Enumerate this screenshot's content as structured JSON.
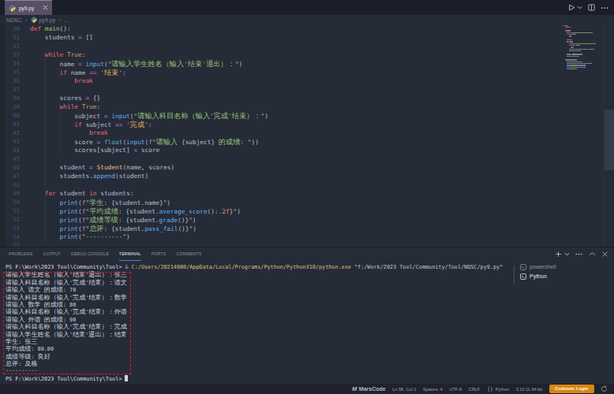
{
  "tab": {
    "label": "py9.py",
    "close_label": "×"
  },
  "editor_actions": {
    "run": "run-python-file",
    "split": "split-editor",
    "more": "more-actions"
  },
  "breadcrumb": {
    "root": "NDSC",
    "file": "py9.py",
    "symbol": "…"
  },
  "editor": {
    "lines": [
      {
        "n": 30,
        "t": [
          [
            "kw",
            "def"
          ],
          [
            "pln",
            " "
          ],
          [
            "fn",
            "main"
          ],
          [
            "pln",
            "():"
          ]
        ]
      },
      {
        "n": 31,
        "t": [
          [
            "pln",
            "    students "
          ],
          [
            "opr",
            "="
          ],
          [
            "pln",
            " []"
          ]
        ]
      },
      {
        "n": 32,
        "t": []
      },
      {
        "n": 33,
        "t": [
          [
            "pln",
            "    "
          ],
          [
            "kw",
            "while"
          ],
          [
            "pln",
            " "
          ],
          [
            "num",
            "True"
          ],
          [
            "pln",
            ":"
          ]
        ]
      },
      {
        "n": 34,
        "t": [
          [
            "pln",
            "        name "
          ],
          [
            "opr",
            "="
          ],
          [
            "pln",
            " "
          ],
          [
            "call",
            "input"
          ],
          [
            "pln",
            "("
          ],
          [
            "str",
            "\"请输入学生姓名（输入'结束'退出）：\""
          ],
          [
            "pln",
            ")"
          ]
        ]
      },
      {
        "n": 35,
        "t": [
          [
            "pln",
            "        "
          ],
          [
            "kw",
            "if"
          ],
          [
            "pln",
            " name "
          ],
          [
            "opr",
            "=="
          ],
          [
            "pln",
            " "
          ],
          [
            "sqs",
            "'结束'"
          ],
          [
            "pln",
            ":"
          ]
        ]
      },
      {
        "n": 36,
        "t": [
          [
            "pln",
            "            "
          ],
          [
            "kw",
            "break"
          ]
        ]
      },
      {
        "n": 37,
        "t": []
      },
      {
        "n": 38,
        "t": [
          [
            "pln",
            "        scores "
          ],
          [
            "opr",
            "="
          ],
          [
            "pln",
            " {}"
          ]
        ]
      },
      {
        "n": 39,
        "t": [
          [
            "pln",
            "        "
          ],
          [
            "kw",
            "while"
          ],
          [
            "pln",
            " "
          ],
          [
            "num",
            "True"
          ],
          [
            "pln",
            ":"
          ]
        ]
      },
      {
        "n": 40,
        "t": [
          [
            "pln",
            "            subject "
          ],
          [
            "opr",
            "="
          ],
          [
            "pln",
            " "
          ],
          [
            "call",
            "input"
          ],
          [
            "pln",
            "("
          ],
          [
            "str",
            "\"请输入科目名称（输入'完成'结束）：\""
          ],
          [
            "pln",
            ")"
          ]
        ]
      },
      {
        "n": 41,
        "t": [
          [
            "pln",
            "            "
          ],
          [
            "kw",
            "if"
          ],
          [
            "pln",
            " subject "
          ],
          [
            "opr",
            "=="
          ],
          [
            "pln",
            " "
          ],
          [
            "sqs",
            "'完成'"
          ],
          [
            "pln",
            ":"
          ]
        ]
      },
      {
        "n": 42,
        "t": [
          [
            "pln",
            "                "
          ],
          [
            "kw",
            "break"
          ]
        ]
      },
      {
        "n": 43,
        "t": [
          [
            "pln",
            "            score "
          ],
          [
            "opr",
            "="
          ],
          [
            "pln",
            " "
          ],
          [
            "cyn",
            "float"
          ],
          [
            "pln",
            "("
          ],
          [
            "call",
            "input"
          ],
          [
            "pln",
            "("
          ],
          [
            "fpx",
            "f"
          ],
          [
            "str",
            "\"请输入 "
          ],
          [
            "pln",
            "{subject}"
          ],
          [
            "str",
            " 的成绩: \""
          ],
          [
            "pln",
            "))"
          ]
        ]
      },
      {
        "n": 44,
        "t": [
          [
            "pln",
            "            scores[subject] "
          ],
          [
            "opr",
            "="
          ],
          [
            "pln",
            " score"
          ]
        ]
      },
      {
        "n": 45,
        "t": []
      },
      {
        "n": 46,
        "t": [
          [
            "pln",
            "        student "
          ],
          [
            "opr",
            "="
          ],
          [
            "pln",
            " "
          ],
          [
            "cls",
            "Student"
          ],
          [
            "pln",
            "(name, scores)"
          ]
        ]
      },
      {
        "n": 47,
        "t": [
          [
            "pln",
            "        students."
          ],
          [
            "call",
            "append"
          ],
          [
            "pln",
            "(student)"
          ]
        ]
      },
      {
        "n": 48,
        "t": []
      },
      {
        "n": 49,
        "t": [
          [
            "pln",
            "    "
          ],
          [
            "kw",
            "for"
          ],
          [
            "pln",
            " student "
          ],
          [
            "kw",
            "in"
          ],
          [
            "pln",
            " students:"
          ]
        ]
      },
      {
        "n": 50,
        "t": [
          [
            "pln",
            "        "
          ],
          [
            "call",
            "print"
          ],
          [
            "pln",
            "("
          ],
          [
            "fpx",
            "f"
          ],
          [
            "str",
            "\"学生: "
          ],
          [
            "pln",
            "{student.name}"
          ],
          [
            "str",
            "\""
          ],
          [
            "pln",
            ")"
          ]
        ]
      },
      {
        "n": 51,
        "t": [
          [
            "pln",
            "        "
          ],
          [
            "call",
            "print"
          ],
          [
            "pln",
            "("
          ],
          [
            "fpx",
            "f"
          ],
          [
            "str",
            "\"平均成绩: "
          ],
          [
            "pln",
            "{student."
          ],
          [
            "call",
            "average_score"
          ],
          [
            "pln",
            "()"
          ],
          [
            "fmt",
            ":.2f"
          ],
          [
            "pln",
            "}"
          ],
          [
            "str",
            "\""
          ],
          [
            "pln",
            ")"
          ]
        ]
      },
      {
        "n": 52,
        "t": [
          [
            "pln",
            "        "
          ],
          [
            "call",
            "print"
          ],
          [
            "pln",
            "("
          ],
          [
            "fpx",
            "f"
          ],
          [
            "str",
            "\"成绩等级: "
          ],
          [
            "pln",
            "{student."
          ],
          [
            "call",
            "grade"
          ],
          [
            "pln",
            "()}"
          ],
          [
            "str",
            "\""
          ],
          [
            "pln",
            ")"
          ]
        ]
      },
      {
        "n": 53,
        "t": [
          [
            "pln",
            "        "
          ],
          [
            "call",
            "print"
          ],
          [
            "pln",
            "("
          ],
          [
            "fpx",
            "f"
          ],
          [
            "str",
            "\"总评: "
          ],
          [
            "pln",
            "{student."
          ],
          [
            "call",
            "pass_fail"
          ],
          [
            "pln",
            "()}"
          ],
          [
            "str",
            "\""
          ],
          [
            "pln",
            ")"
          ]
        ]
      },
      {
        "n": 54,
        "t": [
          [
            "pln",
            "        "
          ],
          [
            "call",
            "print"
          ],
          [
            "pln",
            "("
          ],
          [
            "str",
            "\"----------\""
          ],
          [
            "pln",
            ")"
          ]
        ]
      },
      {
        "n": 55,
        "t": []
      }
    ]
  },
  "panel": {
    "tabs": [
      {
        "label": "PROBLEMS",
        "active": false
      },
      {
        "label": "OUTPUT",
        "active": false
      },
      {
        "label": "DEBUG CONSOLE",
        "active": false
      },
      {
        "label": "TERMINAL",
        "active": true
      },
      {
        "label": "PORTS",
        "active": false
      },
      {
        "label": "COMMENTS",
        "active": false
      }
    ]
  },
  "terminal": {
    "lines": [
      {
        "t": [
          [
            "pmt",
            "PS F:\\Work\\2023 Tool\\Community\\Tool> "
          ],
          [
            "dim",
            "& "
          ],
          [
            "cmd",
            "C:/Users/20214080/AppData/Local/Programs/Python/Python310/python.exe"
          ],
          [
            "arg",
            " \"f:/Work/2023 Tool/Community/Tool/NDSC/py9.py\""
          ]
        ]
      },
      {
        "t": [
          [
            "out",
            "请输入学生姓名（输入'结束'退出）：张三"
          ]
        ]
      },
      {
        "t": [
          [
            "out",
            "请输入科目名称（输入'完成'结束）：语文"
          ]
        ]
      },
      {
        "t": [
          [
            "out",
            "请输入 语文 的成绩: 70"
          ]
        ]
      },
      {
        "t": [
          [
            "out",
            "请输入科目名称（输入'完成'结束）：数学"
          ]
        ]
      },
      {
        "t": [
          [
            "out",
            "请输入 数学 的成绩: 80"
          ]
        ]
      },
      {
        "t": [
          [
            "out",
            "请输入科目名称（输入'完成'结束）：外语"
          ]
        ]
      },
      {
        "t": [
          [
            "out",
            "请输入 外语 的成绩: 90"
          ]
        ]
      },
      {
        "t": [
          [
            "out",
            "请输入科目名称（输入'完成'结束）：完成"
          ]
        ]
      },
      {
        "t": [
          [
            "out",
            "请输入学生姓名（输入'结束'退出）：结束"
          ]
        ]
      },
      {
        "t": [
          [
            "out",
            "学生: 张三"
          ]
        ]
      },
      {
        "t": [
          [
            "out",
            "平均成绩: 80.00"
          ]
        ]
      },
      {
        "t": [
          [
            "out",
            "成绩等级: 良好"
          ]
        ]
      },
      {
        "t": [
          [
            "out",
            "总评: 及格"
          ]
        ]
      },
      {
        "t": [
          [
            "out",
            "----------"
          ]
        ]
      },
      {
        "t": [
          [
            "pmt",
            "PS F:\\Work\\2023 Tool\\Community\\Tool> "
          ]
        ],
        "cursor": true
      }
    ],
    "tabs_list": [
      {
        "label": "powershell",
        "active": false
      },
      {
        "label": "Python",
        "active": true
      }
    ]
  },
  "status_bar": {
    "items": [
      {
        "id": "marscode",
        "label": "MarsCode",
        "icon": "marscode-logo"
      },
      {
        "id": "cursor-position",
        "label": "Ln 58, Col 1"
      },
      {
        "id": "indentation",
        "label": "Spaces: 4"
      },
      {
        "id": "encoding",
        "label": "UTF-8"
      },
      {
        "id": "eol",
        "label": "CRLF"
      },
      {
        "id": "language-mode",
        "label": "Python",
        "icon": "braces-icon"
      },
      {
        "id": "python-interpreter",
        "label": "3.10.11 64-bit"
      },
      {
        "id": "codeium",
        "label": "Codeium: Login",
        "badge": true,
        "color": "#d78612"
      },
      {
        "id": "sync",
        "label": "",
        "icon": "sync-icon"
      }
    ]
  },
  "annotation": {
    "shape": "dashed-rectangle",
    "color": "#ee1414"
  }
}
